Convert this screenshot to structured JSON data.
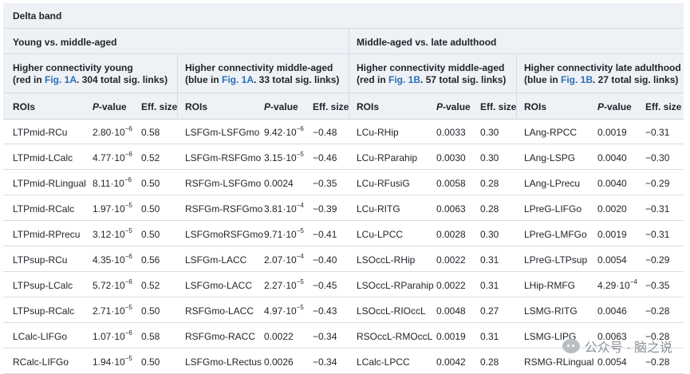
{
  "band": "Delta band",
  "groups": [
    "Young vs. middle-aged",
    "Middle-aged vs. late adulthood"
  ],
  "subheaders": [
    {
      "line1": "Higher connectivity young",
      "pre": "(red in ",
      "link": "Fig. 1A",
      "post": ". 304 total sig. links)"
    },
    {
      "line1": "Higher connectivity middle-aged",
      "pre": "(blue in ",
      "link": "Fig. 1A",
      "post": ". 33 total sig. links)"
    },
    {
      "line1": "Higher connectivity middle-aged",
      "pre": "(red in ",
      "link": "Fig. 1B",
      "post": ". 57 total sig. links)"
    },
    {
      "line1": "Higher connectivity late adulthood",
      "pre": "(blue in ",
      "link": "Fig. 1B",
      "post": ". 27 total sig. links)"
    }
  ],
  "columns": {
    "roi": "ROIs",
    "p_italic": "P",
    "p_rest": "-value",
    "eff": "Eff. size"
  },
  "rows": [
    [
      [
        "LTPmid-RCu",
        "2.80·10",
        "−6",
        "0.58"
      ],
      [
        "LSFGm-LSFGmo",
        "9.42·10",
        "−6",
        "−0.48"
      ],
      [
        "LCu-RHip",
        "0.0033",
        "",
        "0.30"
      ],
      [
        "LAng-RPCC",
        "0.0019",
        "",
        "−0.31"
      ]
    ],
    [
      [
        "LTPmid-LCalc",
        "4.77·10",
        "−6",
        "0.52"
      ],
      [
        "LSFGm-RSFGmo",
        "3.15·10",
        "−5",
        "−0.46"
      ],
      [
        "LCu-RParahip",
        "0.0030",
        "",
        "0.30"
      ],
      [
        "LAng-LSPG",
        "0.0040",
        "",
        "−0.30"
      ]
    ],
    [
      [
        "LTPmid-RLingual",
        "8.11·10",
        "−6",
        "0.50"
      ],
      [
        "RSFGm-LSFGmo",
        "0.0024",
        "",
        "−0.35"
      ],
      [
        "LCu-RFusiG",
        "0.0058",
        "",
        "0.28"
      ],
      [
        "LAng-LPrecu",
        "0.0040",
        "",
        "−0.29"
      ]
    ],
    [
      [
        "LTPmid-RCalc",
        "1.97·10",
        "−5",
        "0.50"
      ],
      [
        "RSFGm-RSFGmo",
        "3.81·10",
        "−4",
        "−0.39"
      ],
      [
        "LCu-RITG",
        "0.0063",
        "",
        "0.28"
      ],
      [
        "LPreG-LIFGo",
        "0.0020",
        "",
        "−0.31"
      ]
    ],
    [
      [
        "LTPmid-RPrecu",
        "3.12·10",
        "−5",
        "0.50"
      ],
      [
        "LSFGmoRSFGmo",
        "9.71·10",
        "−5",
        "−0.41"
      ],
      [
        "LCu-LPCC",
        "0.0028",
        "",
        "0.30"
      ],
      [
        "LPreG-LMFGo",
        "0.0019",
        "",
        "−0.31"
      ]
    ],
    [
      [
        "LTPsup-RCu",
        "4.35·10",
        "−6",
        "0.56"
      ],
      [
        "LSFGm-LACC",
        "2.07·10",
        "−4",
        "−0.40"
      ],
      [
        "LSOccL-RHip",
        "0.0022",
        "",
        "0.31"
      ],
      [
        "LPreG-LTPsup",
        "0.0054",
        "",
        "−0.29"
      ]
    ],
    [
      [
        "LTPsup-LCalc",
        "5.72·10",
        "−6",
        "0.52"
      ],
      [
        "LSFGmo-LACC",
        "2.27·10",
        "−5",
        "−0.45"
      ],
      [
        "LSOccL-RParahip",
        "0.0022",
        "",
        "0.31"
      ],
      [
        "LHip-RMFG",
        "4.29·10",
        "−4",
        "−0.35"
      ]
    ],
    [
      [
        "LTPsup-RCalc",
        "2.71·10",
        "−5",
        "0.50"
      ],
      [
        "RSFGmo-LACC",
        "4.97·10",
        "−5",
        "−0.43"
      ],
      [
        "LSOccL-RIOccL",
        "0.0048",
        "",
        "0.27"
      ],
      [
        "LSMG-RITG",
        "0.0046",
        "",
        "−0.28"
      ]
    ],
    [
      [
        "LCalc-LIFGo",
        "1.07·10",
        "−6",
        "0.58"
      ],
      [
        "RSFGmo-RACC",
        "0.0022",
        "",
        "−0.34"
      ],
      [
        "RSOccL-RMOccL",
        "0.0019",
        "",
        "0.31"
      ],
      [
        "LSMG-LIPG",
        "0.0063",
        "",
        "−0.28"
      ]
    ],
    [
      [
        "RCalc-LIFGo",
        "1.94·10",
        "−5",
        "0.50"
      ],
      [
        "LSFGmo-LRectus",
        "0.0026",
        "",
        "−0.34"
      ],
      [
        "LCalc-LPCC",
        "0.0042",
        "",
        "0.28"
      ],
      [
        "RSMG-RLingual",
        "0.0054",
        "",
        "−0.28"
      ]
    ]
  ],
  "watermark": "公众号 · 脑之说"
}
